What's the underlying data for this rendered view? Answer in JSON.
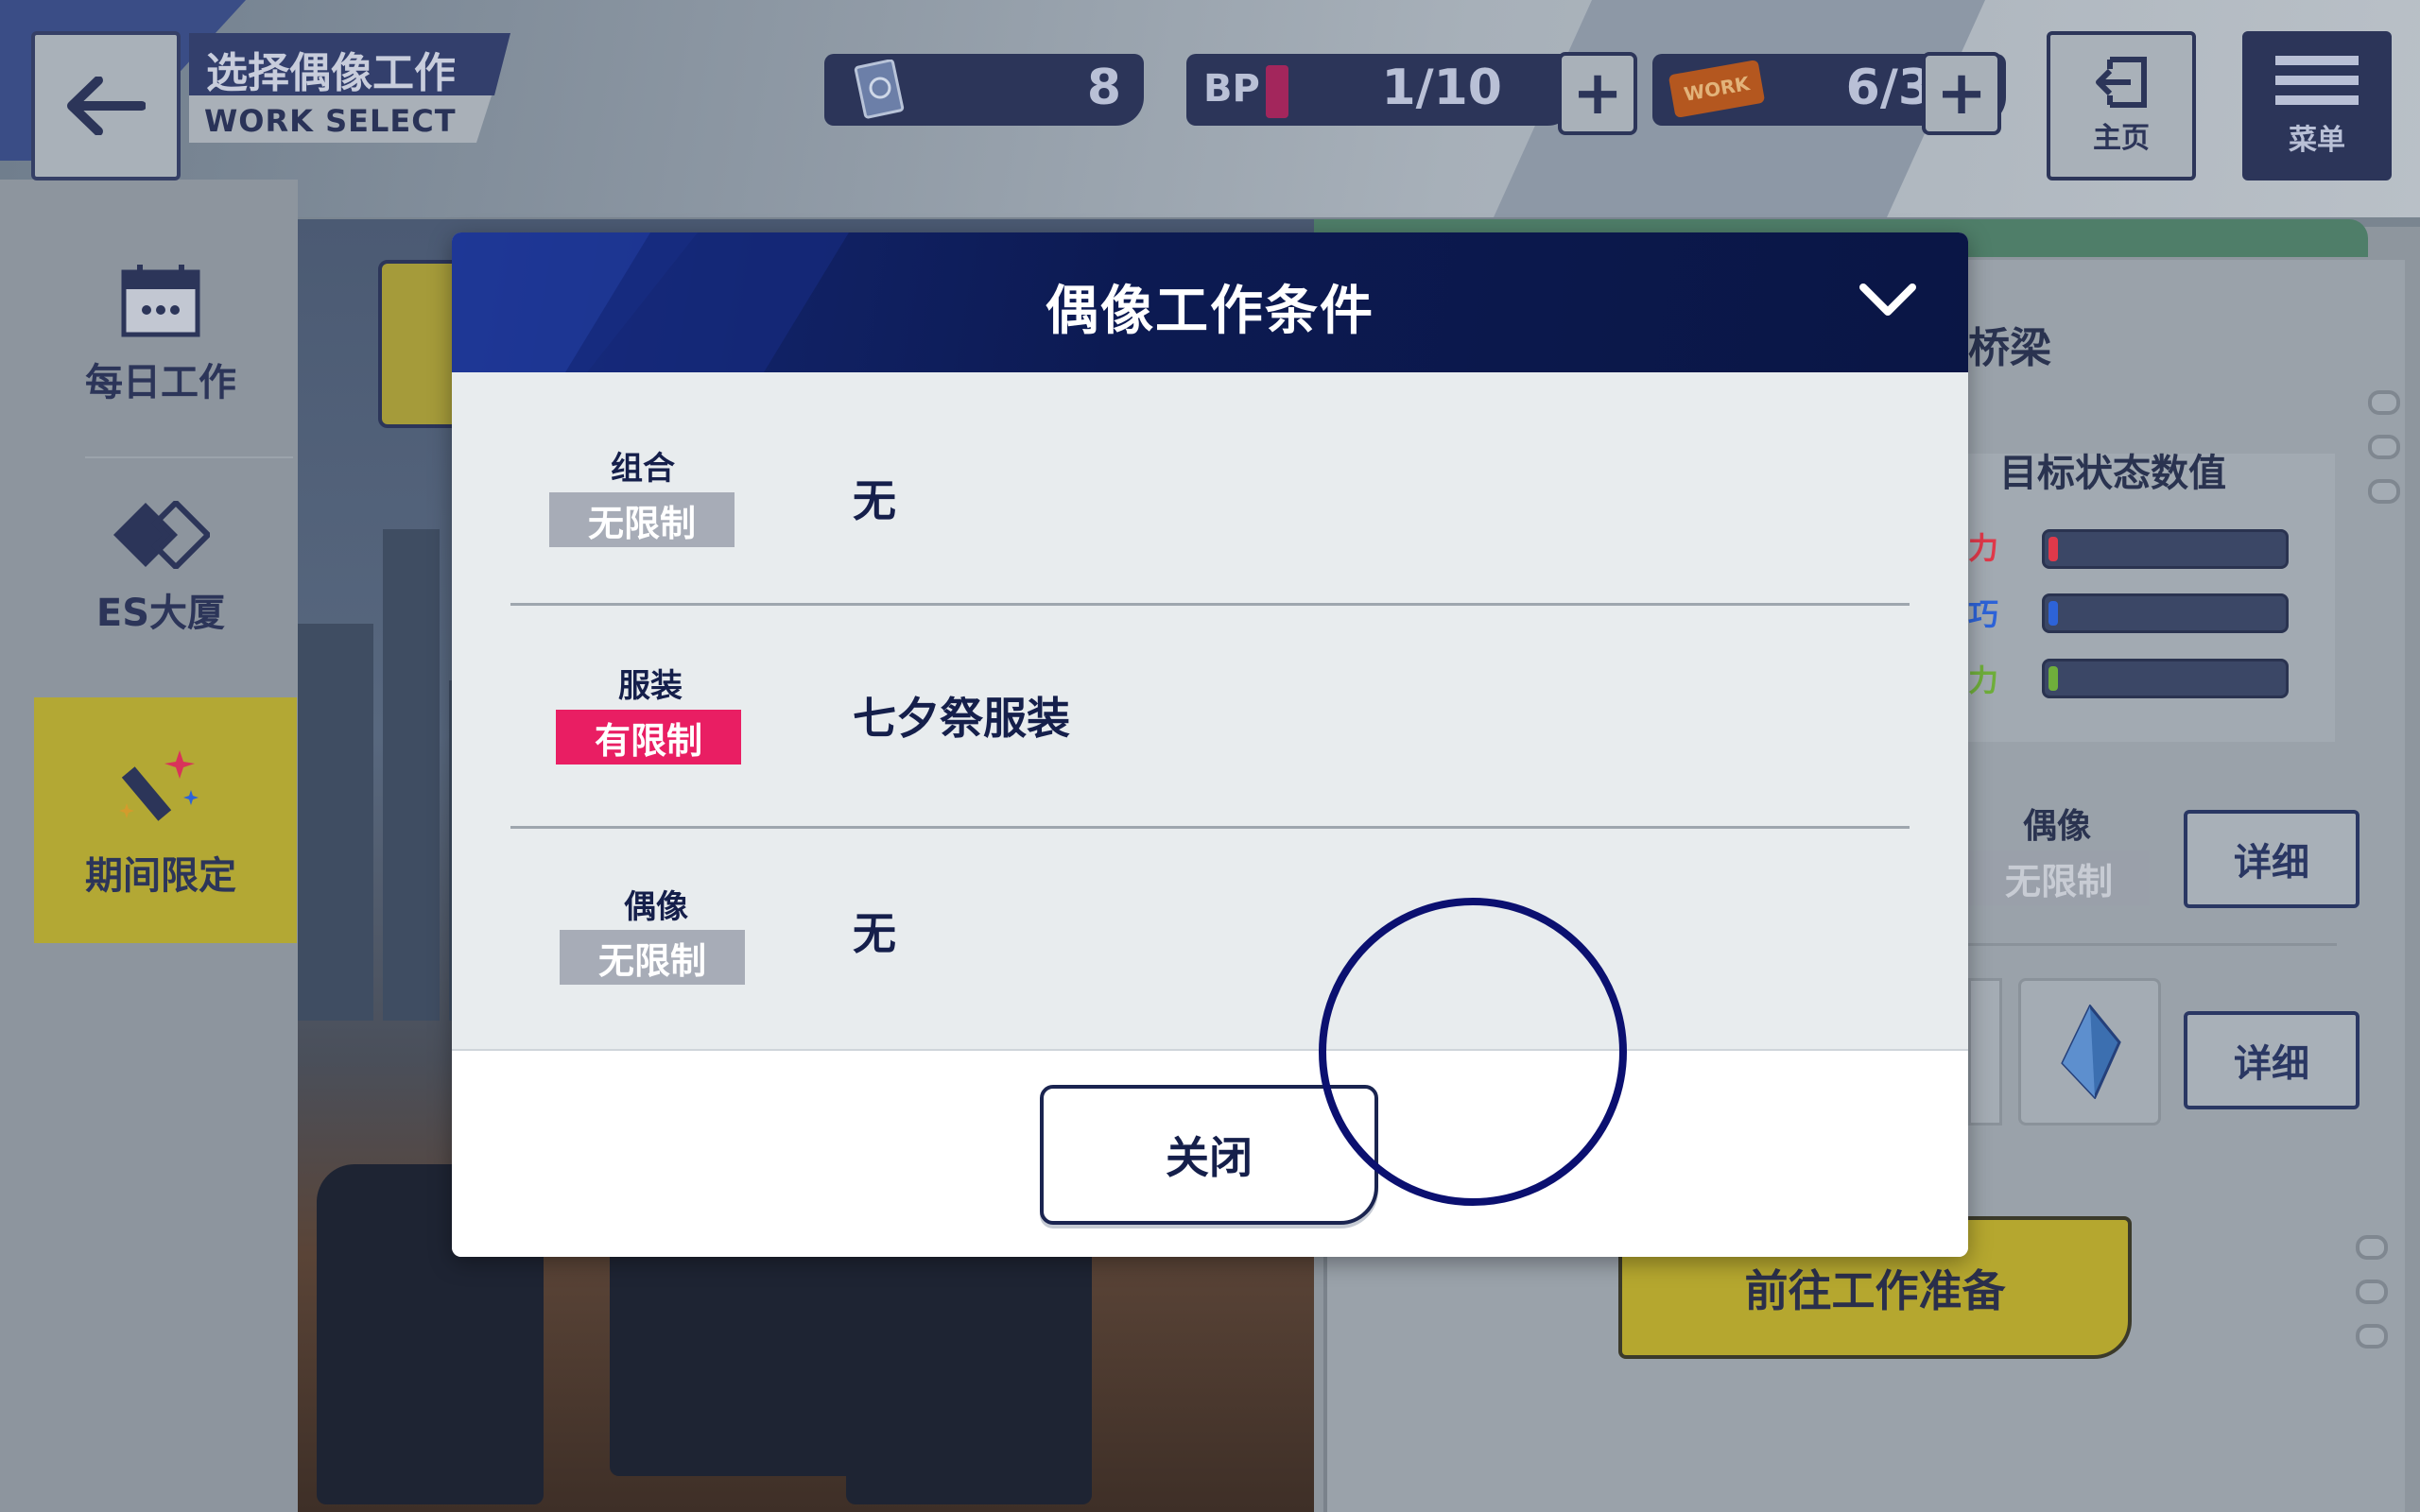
{
  "header": {
    "title_cn": "选择偶像工作",
    "title_en": "WORK SELECT",
    "resources": {
      "card_count": "8",
      "bp_label": "BP",
      "bp_value": "1/10",
      "work_value": "6/3",
      "work_ticket_text": "WORK"
    },
    "home_label": "主页",
    "menu_label": "菜单"
  },
  "sidebar": {
    "items": [
      {
        "label": "每日工作",
        "icon": "calendar-icon"
      },
      {
        "label": "ES大厦",
        "icon": "es-building-icon"
      },
      {
        "label": "期间限定",
        "icon": "limited-event-icon",
        "active": true
      }
    ]
  },
  "background_panel": {
    "title_fragment": "桥梁",
    "stats_title": "目标状态数值",
    "stat_fragments": [
      "力",
      "巧",
      "力"
    ],
    "stat_colors": [
      "#e0394a",
      "#2d63d8",
      "#6fae3b"
    ],
    "idol_label": "偶像",
    "idol_tag": "无限制",
    "detail_label": "详细",
    "go_button": "前往工作准备"
  },
  "modal": {
    "title": "偶像工作条件",
    "conditions": [
      {
        "category": "组合",
        "tag": "无限制",
        "restricted": false,
        "value": "无"
      },
      {
        "category": "服装",
        "tag": "有限制",
        "restricted": true,
        "value": "七夕祭服装"
      },
      {
        "category": "偶像",
        "tag": "无限制",
        "restricted": false,
        "value": "无"
      }
    ],
    "close_label": "关闭"
  },
  "colors": {
    "navy": "#0c1a52",
    "restricted_tag": "#e91e63",
    "unrestricted_tag": "#a7acb7",
    "accent_gold": "#b5a72f"
  }
}
